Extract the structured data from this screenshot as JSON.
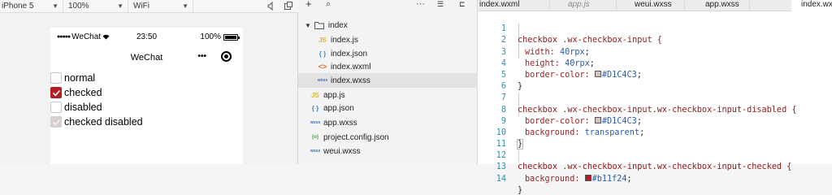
{
  "simulator": {
    "device": "iPhone 5",
    "zoom": "100%",
    "network": "WiFi",
    "status_bar": {
      "carrier": "WeChat",
      "time": "23:50",
      "battery": "100%"
    },
    "nav_title": "WeChat",
    "checkboxes": [
      {
        "label": "normal",
        "state": "unchecked"
      },
      {
        "label": "checked",
        "state": "checked"
      },
      {
        "label": "disabled",
        "state": "disabled"
      },
      {
        "label": "checked disabled",
        "state": "checked-disabled"
      }
    ]
  },
  "file_tree": {
    "folder": "index",
    "items": [
      {
        "name": "index.js",
        "icon": "js-icon",
        "badge": "JS"
      },
      {
        "name": "index.json",
        "icon": "json-icon",
        "badge": "{ }"
      },
      {
        "name": "index.wxml",
        "icon": "wxml-icon",
        "badge": "<>"
      },
      {
        "name": "index.wxss",
        "icon": "wxss-icon",
        "badge": "wxss"
      },
      {
        "name": "app.js",
        "icon": "js-icon",
        "badge": "JS"
      },
      {
        "name": "app.json",
        "icon": "json-icon",
        "badge": "{ }"
      },
      {
        "name": "app.wxss",
        "icon": "wxss-icon",
        "badge": "wxss"
      },
      {
        "name": "project.config.json",
        "icon": "config-icon",
        "badge": "{o}"
      },
      {
        "name": "weui.wxss",
        "icon": "wxss-icon",
        "badge": "wxss"
      }
    ]
  },
  "editor": {
    "tabs": [
      "index.wxml",
      "app.js",
      "weui.wxss",
      "app.wxss",
      "index.wxss"
    ],
    "line_numbers": [
      "1",
      "2",
      "3",
      "4",
      "5",
      "6",
      "7",
      "8",
      "9",
      "10",
      "11",
      "12",
      "13",
      "14"
    ],
    "code": {
      "l1_selector": "checkbox .wx-checkbox-input {",
      "l2_prop": "width: ",
      "l2_val": "40rpx",
      "l3_prop": "height: ",
      "l3_val": "40rpx",
      "l4_prop": "border-color: ",
      "l4_val": "#D1C4C3",
      "close": "}",
      "l7_selector": "checkbox .wx-checkbox-input.wx-checkbox-input-disabled {",
      "l8_prop": "border-color: ",
      "l8_val": "#D1C4C3",
      "l9_prop": "background: ",
      "l9_val": "transparent",
      "l12_selector": "checkbox .wx-checkbox-input.wx-checkbox-input-checked {",
      "l13_prop": "background: ",
      "l13_val": "#b11f24",
      "semi": ";"
    },
    "swatch_colors": {
      "border": "#D1C4C3",
      "checked": "#b11f24"
    }
  }
}
